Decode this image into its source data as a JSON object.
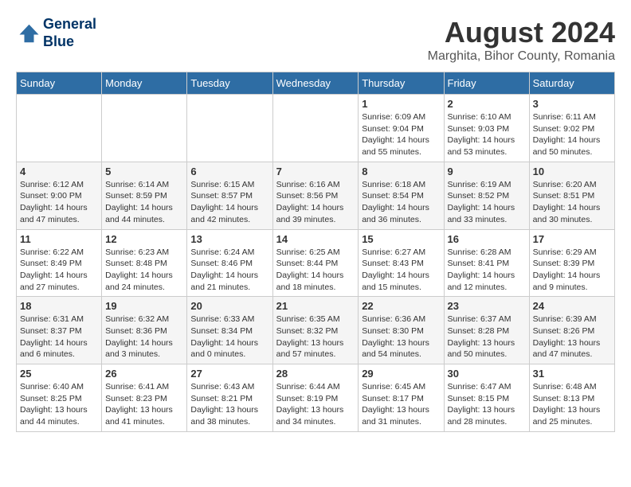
{
  "header": {
    "logo_line1": "General",
    "logo_line2": "Blue",
    "month_year": "August 2024",
    "location": "Marghita, Bihor County, Romania"
  },
  "weekdays": [
    "Sunday",
    "Monday",
    "Tuesday",
    "Wednesday",
    "Thursday",
    "Friday",
    "Saturday"
  ],
  "weeks": [
    [
      {
        "day": "",
        "info": ""
      },
      {
        "day": "",
        "info": ""
      },
      {
        "day": "",
        "info": ""
      },
      {
        "day": "",
        "info": ""
      },
      {
        "day": "1",
        "info": "Sunrise: 6:09 AM\nSunset: 9:04 PM\nDaylight: 14 hours and 55 minutes."
      },
      {
        "day": "2",
        "info": "Sunrise: 6:10 AM\nSunset: 9:03 PM\nDaylight: 14 hours and 53 minutes."
      },
      {
        "day": "3",
        "info": "Sunrise: 6:11 AM\nSunset: 9:02 PM\nDaylight: 14 hours and 50 minutes."
      }
    ],
    [
      {
        "day": "4",
        "info": "Sunrise: 6:12 AM\nSunset: 9:00 PM\nDaylight: 14 hours and 47 minutes."
      },
      {
        "day": "5",
        "info": "Sunrise: 6:14 AM\nSunset: 8:59 PM\nDaylight: 14 hours and 44 minutes."
      },
      {
        "day": "6",
        "info": "Sunrise: 6:15 AM\nSunset: 8:57 PM\nDaylight: 14 hours and 42 minutes."
      },
      {
        "day": "7",
        "info": "Sunrise: 6:16 AM\nSunset: 8:56 PM\nDaylight: 14 hours and 39 minutes."
      },
      {
        "day": "8",
        "info": "Sunrise: 6:18 AM\nSunset: 8:54 PM\nDaylight: 14 hours and 36 minutes."
      },
      {
        "day": "9",
        "info": "Sunrise: 6:19 AM\nSunset: 8:52 PM\nDaylight: 14 hours and 33 minutes."
      },
      {
        "day": "10",
        "info": "Sunrise: 6:20 AM\nSunset: 8:51 PM\nDaylight: 14 hours and 30 minutes."
      }
    ],
    [
      {
        "day": "11",
        "info": "Sunrise: 6:22 AM\nSunset: 8:49 PM\nDaylight: 14 hours and 27 minutes."
      },
      {
        "day": "12",
        "info": "Sunrise: 6:23 AM\nSunset: 8:48 PM\nDaylight: 14 hours and 24 minutes."
      },
      {
        "day": "13",
        "info": "Sunrise: 6:24 AM\nSunset: 8:46 PM\nDaylight: 14 hours and 21 minutes."
      },
      {
        "day": "14",
        "info": "Sunrise: 6:25 AM\nSunset: 8:44 PM\nDaylight: 14 hours and 18 minutes."
      },
      {
        "day": "15",
        "info": "Sunrise: 6:27 AM\nSunset: 8:43 PM\nDaylight: 14 hours and 15 minutes."
      },
      {
        "day": "16",
        "info": "Sunrise: 6:28 AM\nSunset: 8:41 PM\nDaylight: 14 hours and 12 minutes."
      },
      {
        "day": "17",
        "info": "Sunrise: 6:29 AM\nSunset: 8:39 PM\nDaylight: 14 hours and 9 minutes."
      }
    ],
    [
      {
        "day": "18",
        "info": "Sunrise: 6:31 AM\nSunset: 8:37 PM\nDaylight: 14 hours and 6 minutes."
      },
      {
        "day": "19",
        "info": "Sunrise: 6:32 AM\nSunset: 8:36 PM\nDaylight: 14 hours and 3 minutes."
      },
      {
        "day": "20",
        "info": "Sunrise: 6:33 AM\nSunset: 8:34 PM\nDaylight: 14 hours and 0 minutes."
      },
      {
        "day": "21",
        "info": "Sunrise: 6:35 AM\nSunset: 8:32 PM\nDaylight: 13 hours and 57 minutes."
      },
      {
        "day": "22",
        "info": "Sunrise: 6:36 AM\nSunset: 8:30 PM\nDaylight: 13 hours and 54 minutes."
      },
      {
        "day": "23",
        "info": "Sunrise: 6:37 AM\nSunset: 8:28 PM\nDaylight: 13 hours and 50 minutes."
      },
      {
        "day": "24",
        "info": "Sunrise: 6:39 AM\nSunset: 8:26 PM\nDaylight: 13 hours and 47 minutes."
      }
    ],
    [
      {
        "day": "25",
        "info": "Sunrise: 6:40 AM\nSunset: 8:25 PM\nDaylight: 13 hours and 44 minutes."
      },
      {
        "day": "26",
        "info": "Sunrise: 6:41 AM\nSunset: 8:23 PM\nDaylight: 13 hours and 41 minutes."
      },
      {
        "day": "27",
        "info": "Sunrise: 6:43 AM\nSunset: 8:21 PM\nDaylight: 13 hours and 38 minutes."
      },
      {
        "day": "28",
        "info": "Sunrise: 6:44 AM\nSunset: 8:19 PM\nDaylight: 13 hours and 34 minutes."
      },
      {
        "day": "29",
        "info": "Sunrise: 6:45 AM\nSunset: 8:17 PM\nDaylight: 13 hours and 31 minutes."
      },
      {
        "day": "30",
        "info": "Sunrise: 6:47 AM\nSunset: 8:15 PM\nDaylight: 13 hours and 28 minutes."
      },
      {
        "day": "31",
        "info": "Sunrise: 6:48 AM\nSunset: 8:13 PM\nDaylight: 13 hours and 25 minutes."
      }
    ]
  ]
}
